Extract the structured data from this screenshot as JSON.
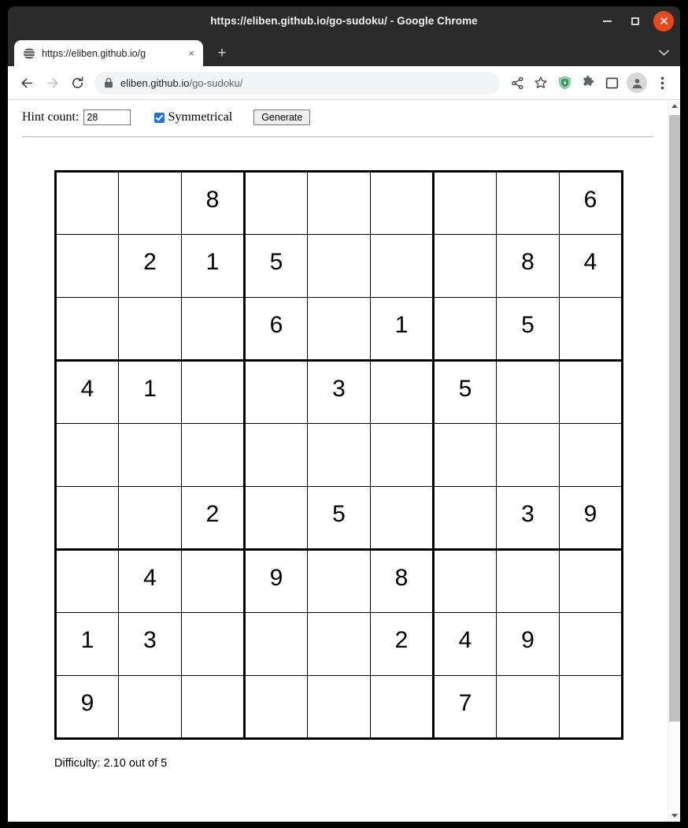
{
  "window": {
    "title": "https://eliben.github.io/go-sudoku/ - Google Chrome",
    "minimize_label": "Minimize",
    "maximize_label": "Maximize",
    "close_label": "Close"
  },
  "browser": {
    "tab": {
      "title": "https://eliben.github.io/g",
      "favicon": "globe-icon",
      "close_label": "×"
    },
    "new_tab_label": "+",
    "tab_list_icon": "chevron-down-icon",
    "nav": {
      "back_icon": "back-arrow-icon",
      "forward_icon": "forward-arrow-icon",
      "reload_icon": "reload-icon"
    },
    "omnibox": {
      "lock_icon": "lock-icon",
      "url_domain": "eliben.github.io",
      "url_path": "/go-sudoku/"
    },
    "actions": [
      {
        "name": "share-icon",
        "label": "Share"
      },
      {
        "name": "bookmark-star-icon",
        "label": "Bookmark this tab"
      },
      {
        "name": "shield-extension-icon",
        "label": "Privacy Badger",
        "color": "#2e9e5b"
      },
      {
        "name": "puzzle-extensions-icon",
        "label": "Extensions",
        "color": "#5f6368"
      },
      {
        "name": "side-panel-icon",
        "label": "Side panel",
        "color": "#5f6368"
      },
      {
        "name": "profile-avatar-icon",
        "label": "Profile"
      },
      {
        "name": "chrome-menu-icon",
        "label": "Customize and control Google Chrome"
      }
    ]
  },
  "page": {
    "controls": {
      "hint_label": "Hint count:",
      "hint_value": "28",
      "hint_placeholder": "",
      "symmetrical_label": "Symmetrical",
      "symmetrical_checked": true,
      "generate_label": "Generate"
    },
    "difficulty_text": "Difficulty: 2.10 out of 5",
    "grid": [
      [
        "",
        "",
        "8",
        "",
        "",
        "",
        "",
        "",
        "6"
      ],
      [
        "",
        "2",
        "1",
        "5",
        "",
        "",
        "",
        "8",
        "4"
      ],
      [
        "",
        "",
        "",
        "6",
        "",
        "1",
        "",
        "5",
        ""
      ],
      [
        "4",
        "1",
        "",
        "",
        "3",
        "",
        "5",
        "",
        ""
      ],
      [
        "",
        "",
        "",
        "",
        "",
        "",
        "",
        "",
        ""
      ],
      [
        "",
        "",
        "2",
        "",
        "5",
        "",
        "",
        "3",
        "9"
      ],
      [
        "",
        "4",
        "",
        "9",
        "",
        "8",
        "",
        "",
        ""
      ],
      [
        "1",
        "3",
        "",
        "",
        "",
        "2",
        "4",
        "9",
        ""
      ],
      [
        "9",
        "",
        "",
        "",
        "",
        "",
        "7",
        "",
        ""
      ]
    ]
  },
  "scrollbar": {
    "up_icon": "triangle-up-icon",
    "down_icon": "triangle-down-icon"
  },
  "colors": {
    "accent": "#1a73e8",
    "close_button": "#e8481c",
    "titlebar": "#2b2b2b",
    "omnibox_bg": "#f1f3f4"
  }
}
